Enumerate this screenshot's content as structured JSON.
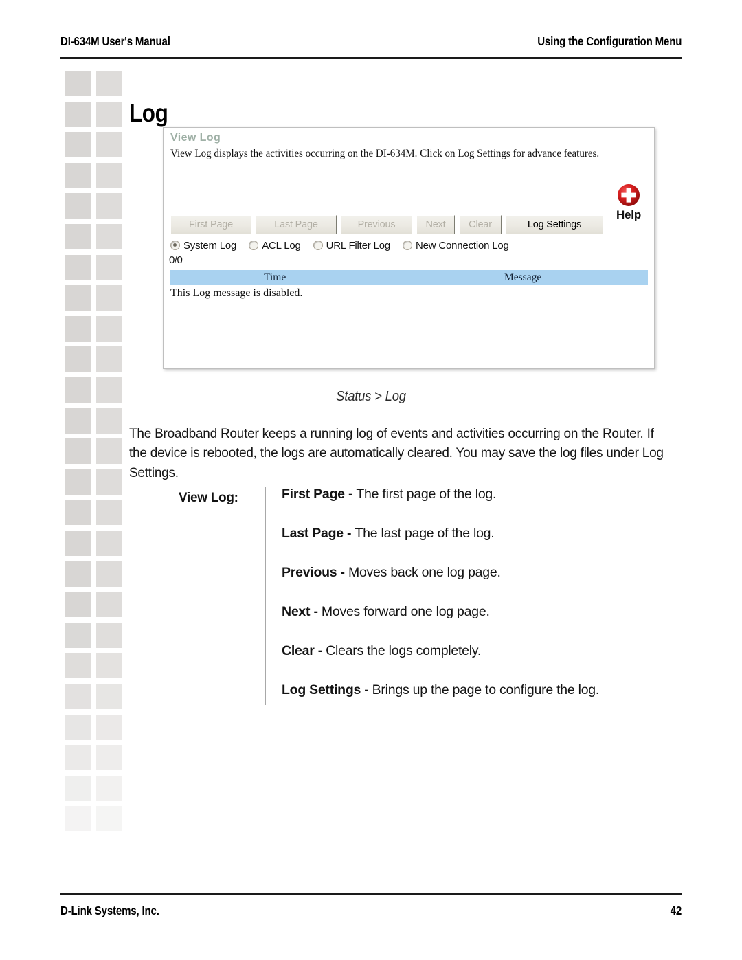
{
  "header": {
    "left": "DI-634M User's Manual",
    "right": "Using the Configuration Menu"
  },
  "section_title": "Log",
  "screenshot_panel": {
    "title": "View Log",
    "description": "View Log displays the activities occurring on the DI-634M. Click on Log Settings for advance features.",
    "help": {
      "icon": "help-plus-icon",
      "label": "Help"
    },
    "buttons": [
      {
        "label": "First Page",
        "enabled": false
      },
      {
        "label": "Last Page",
        "enabled": false
      },
      {
        "label": "Previous",
        "enabled": false
      },
      {
        "label": "Next",
        "enabled": false
      },
      {
        "label": "Clear",
        "enabled": false
      },
      {
        "label": "Log Settings",
        "enabled": true
      }
    ],
    "radios": [
      {
        "label": "System Log",
        "checked": true
      },
      {
        "label": "ACL Log",
        "checked": false
      },
      {
        "label": "URL Filter Log",
        "checked": false
      },
      {
        "label": "New Connection Log",
        "checked": false
      }
    ],
    "counter": "0/0",
    "table": {
      "columns": [
        "Time",
        "Message"
      ],
      "empty_message": "This Log message is disabled.",
      "header_color": "#a9d2f0"
    }
  },
  "status_caption": "Status > Log",
  "body_paragraph": "The Broadband Router keeps a running log of events and activities occurring on the Router. If the device is rebooted, the logs are automatically cleared. You may save the log files under Log Settings.",
  "definitions": {
    "label": "View Log:",
    "items": [
      {
        "term": "First Page",
        "sep": " - ",
        "desc": "The first page of the log."
      },
      {
        "term": "Last Page",
        "sep": " - ",
        "desc": "The last page of the log."
      },
      {
        "term": "Previous",
        "sep": " - ",
        "desc": "Moves back one log page."
      },
      {
        "term": "Next",
        "sep": " - ",
        "desc": "Moves forward one log page."
      },
      {
        "term": "Clear",
        "sep": " - ",
        "desc": "Clears the logs completely."
      },
      {
        "term": "Log Settings",
        "sep": " - ",
        "desc": "Brings up the page to configure the log."
      }
    ]
  },
  "footer": {
    "left": "D-Link Systems, Inc.",
    "right": "42"
  }
}
